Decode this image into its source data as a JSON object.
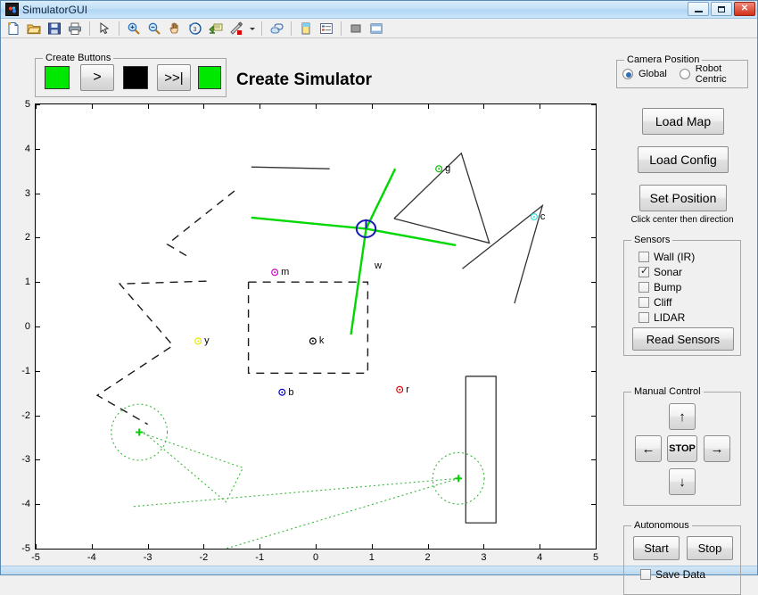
{
  "window": {
    "title": "SimulatorGUI",
    "icon": "matlab-icon",
    "buttons": [
      {
        "name": "minimize-button",
        "glyph": "minimize"
      },
      {
        "name": "maximize-button",
        "glyph": "maximize"
      },
      {
        "name": "close-button",
        "glyph": "✕"
      }
    ]
  },
  "toolbar": {
    "items": [
      {
        "name": "new-figure-icon",
        "label": "New"
      },
      {
        "name": "open-file-icon",
        "label": "Open"
      },
      {
        "name": "save-figure-icon",
        "label": "Save"
      },
      {
        "name": "print-figure-icon",
        "label": "Print"
      },
      {
        "name": "sep",
        "label": ""
      },
      {
        "name": "pointer-select-icon",
        "label": "Edit Plot"
      },
      {
        "name": "sep",
        "label": ""
      },
      {
        "name": "zoom-in-icon",
        "label": "Zoom In"
      },
      {
        "name": "zoom-out-icon",
        "label": "Zoom Out"
      },
      {
        "name": "pan-hand-icon",
        "label": "Pan"
      },
      {
        "name": "rotate-3d-icon",
        "label": "Rotate 3D"
      },
      {
        "name": "data-cursor-icon",
        "label": "Data Cursor"
      },
      {
        "name": "brush-icon",
        "label": "Brush/Select Data"
      },
      {
        "name": "chevron-down-icon",
        "label": ""
      },
      {
        "name": "sep",
        "label": ""
      },
      {
        "name": "link-plot-icon",
        "label": "Link Plot"
      },
      {
        "name": "sep",
        "label": ""
      },
      {
        "name": "colorbar-icon",
        "label": "Insert Colorbar"
      },
      {
        "name": "legend-icon",
        "label": "Insert Legend"
      },
      {
        "name": "sep",
        "label": ""
      },
      {
        "name": "hide-plot-tools-icon",
        "label": "Hide Plot Tools"
      },
      {
        "name": "show-plot-tools-icon",
        "label": "Show Plot Tools"
      }
    ]
  },
  "create_buttons": {
    "legend": "Create Buttons",
    "items": [
      {
        "name": "green-indicator-left",
        "kind": "swatch",
        "color": "#00e800",
        "label": ""
      },
      {
        "name": "step-forward-button",
        "kind": "button",
        "label": ">"
      },
      {
        "name": "black-indicator",
        "kind": "swatch",
        "color": "#000000",
        "label": ""
      },
      {
        "name": "run-to-end-button",
        "kind": "button",
        "label": ">>|"
      },
      {
        "name": "green-indicator-right",
        "kind": "swatch",
        "color": "#00e800",
        "label": ""
      }
    ]
  },
  "plot": {
    "title": "Create Simulator",
    "xlabel": "",
    "ylabel": "",
    "background": "#ffffff"
  },
  "camera": {
    "legend": "Camera Position",
    "options": [
      {
        "label": "Global",
        "selected": true
      },
      {
        "label": "Robot Centric",
        "selected": false
      }
    ]
  },
  "actions": {
    "load_map": "Load Map",
    "load_config": "Load Config",
    "set_position": "Set Position",
    "set_position_hint": "Click center then direction"
  },
  "sensors": {
    "legend": "Sensors",
    "items": [
      {
        "label": "Wall (IR)",
        "checked": false
      },
      {
        "label": "Sonar",
        "checked": true
      },
      {
        "label": "Bump",
        "checked": false
      },
      {
        "label": "Cliff",
        "checked": false
      },
      {
        "label": "LIDAR",
        "checked": false
      }
    ],
    "read_button": "Read Sensors"
  },
  "manual_control": {
    "legend": "Manual Control",
    "up": "↑",
    "down": "↓",
    "left": "←",
    "right": "→",
    "stop": "STOP"
  },
  "autonomous": {
    "legend": "Autonomous",
    "start": "Start",
    "stop": "Stop",
    "save_data": "Save Data",
    "save_data_checked": false
  },
  "chart_data": {
    "type": "scatter",
    "title": "Create Simulator",
    "xlabel": "",
    "ylabel": "",
    "xlim": [
      -5,
      5
    ],
    "ylim": [
      -5,
      5
    ],
    "xticks": [
      -5,
      -4,
      -3,
      -2,
      -1,
      0,
      1,
      2,
      3,
      4,
      5
    ],
    "yticks": [
      -5,
      -4,
      -3,
      -2,
      -1,
      0,
      1,
      2,
      3,
      4,
      5
    ],
    "grid": false,
    "legend": "none",
    "robot": {
      "name": "robot-marker",
      "x": 0.9,
      "y": 2.2,
      "radius": 0.17,
      "heading_deg": 90,
      "color": "#1a1ab4"
    },
    "beacons": [
      {
        "label": "g",
        "x": 2.2,
        "y": 3.55,
        "color": "#00c000"
      },
      {
        "label": "c",
        "x": 3.9,
        "y": 2.47,
        "color": "#3ddede"
      },
      {
        "label": "m",
        "x": -0.73,
        "y": 1.22,
        "color": "#d000d0"
      },
      {
        "label": "y",
        "x": -2.1,
        "y": -0.33,
        "color": "#e8e800"
      },
      {
        "label": "k",
        "x": -0.05,
        "y": -0.33,
        "color": "#000000"
      },
      {
        "label": "b",
        "x": -0.6,
        "y": -1.48,
        "color": "#0000c8"
      },
      {
        "label": "r",
        "x": 1.5,
        "y": -1.42,
        "color": "#e00000"
      }
    ],
    "wall_label": {
      "text": "w",
      "x": 1.05,
      "y": 1.35
    },
    "solid_walls": [
      {
        "name": "top-wall",
        "points": [
          [
            -1.15,
            3.59
          ],
          [
            0.25,
            3.55
          ]
        ]
      },
      {
        "name": "obstacle-upper-right",
        "points": [
          [
            1.4,
            2.43
          ],
          [
            2.6,
            3.9
          ],
          [
            3.1,
            1.88
          ],
          [
            1.4,
            2.43
          ]
        ]
      },
      {
        "name": "obstacle-right",
        "points": [
          [
            2.62,
            1.3
          ],
          [
            4.05,
            2.72
          ],
          [
            3.55,
            0.52
          ]
        ]
      },
      {
        "name": "rectangle-block",
        "points": [
          [
            2.68,
            -1.12
          ],
          [
            3.22,
            -1.12
          ],
          [
            3.22,
            -4.42
          ],
          [
            2.68,
            -4.42
          ],
          [
            2.68,
            -1.12
          ]
        ]
      }
    ],
    "dashed_walls": [
      {
        "name": "zigzag-left",
        "points": [
          [
            -1.45,
            3.05
          ],
          [
            -2.65,
            1.85
          ],
          [
            -2.25,
            1.55
          ]
        ]
      },
      {
        "name": "zigzag-left-lower",
        "points": [
          [
            -1.95,
            1.02
          ],
          [
            -3.5,
            0.96
          ],
          [
            -2.55,
            -0.43
          ],
          [
            -3.9,
            -1.55
          ],
          [
            -3.0,
            -2.2
          ]
        ]
      },
      {
        "name": "dashed-box",
        "points": [
          [
            -1.2,
            1.0
          ],
          [
            0.93,
            1.0
          ],
          [
            0.93,
            -1.05
          ],
          [
            -1.2,
            -1.05
          ],
          [
            -1.2,
            1.0
          ]
        ]
      }
    ],
    "sonar_rays": [
      {
        "from": [
          0.9,
          2.2
        ],
        "to": [
          -1.15,
          2.45
        ]
      },
      {
        "from": [
          0.9,
          2.2
        ],
        "to": [
          2.5,
          1.83
        ]
      },
      {
        "from": [
          0.9,
          2.2
        ],
        "to": [
          1.42,
          3.55
        ]
      },
      {
        "from": [
          0.9,
          2.2
        ],
        "to": [
          0.63,
          -0.18
        ]
      }
    ],
    "particle_trails": [
      {
        "name": "trail-left",
        "points": [
          [
            -3.15,
            -2.38
          ],
          [
            -1.3,
            -3.18
          ],
          [
            -1.6,
            -3.95
          ],
          [
            -3.1,
            -2.35
          ]
        ]
      },
      {
        "name": "trail-right",
        "points": [
          [
            -3.25,
            -4.05
          ],
          [
            2.55,
            -3.42
          ],
          [
            -1.6,
            -5.0
          ]
        ]
      }
    ],
    "particle_circles": [
      {
        "name": "estimate-circle-left",
        "x": -3.15,
        "y": -2.38,
        "r": 0.5
      },
      {
        "name": "estimate-circle-right",
        "x": 2.55,
        "y": -3.42,
        "r": 0.46
      }
    ],
    "particle_markers": [
      {
        "name": "estimate-plus-left",
        "x": -3.15,
        "y": -2.38,
        "color": "#00d000"
      },
      {
        "name": "estimate-plus-right",
        "x": 2.55,
        "y": -3.42,
        "color": "#00d000"
      }
    ]
  }
}
